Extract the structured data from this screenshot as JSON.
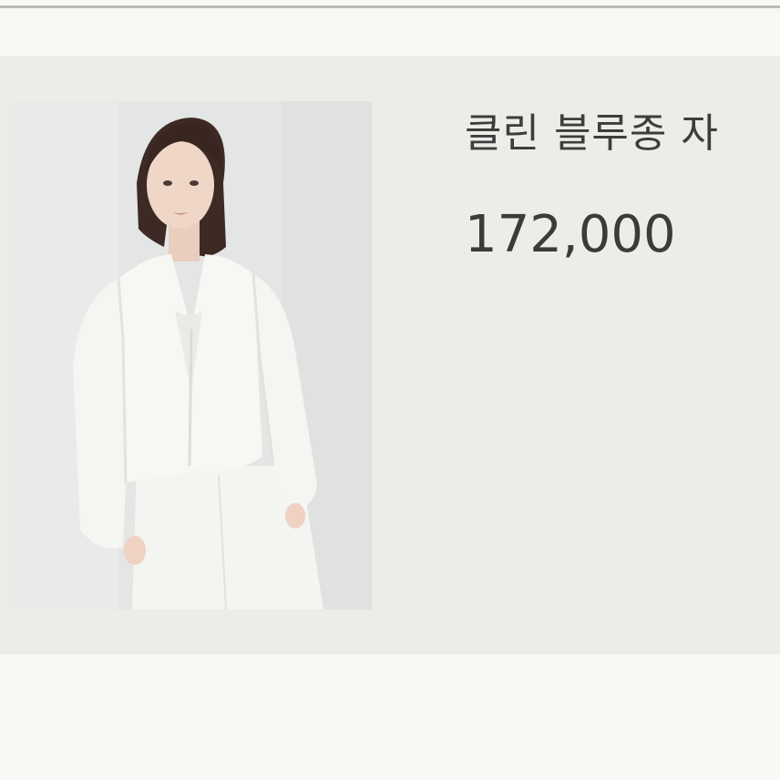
{
  "product": {
    "title": "클린 블루종 자",
    "price": "172,000",
    "image_subject": "model wearing white cropped blouson jacket"
  },
  "colors": {
    "page_background": "#f8f8f5",
    "card_background": "#ecece8",
    "text": "#3d3d3d"
  }
}
